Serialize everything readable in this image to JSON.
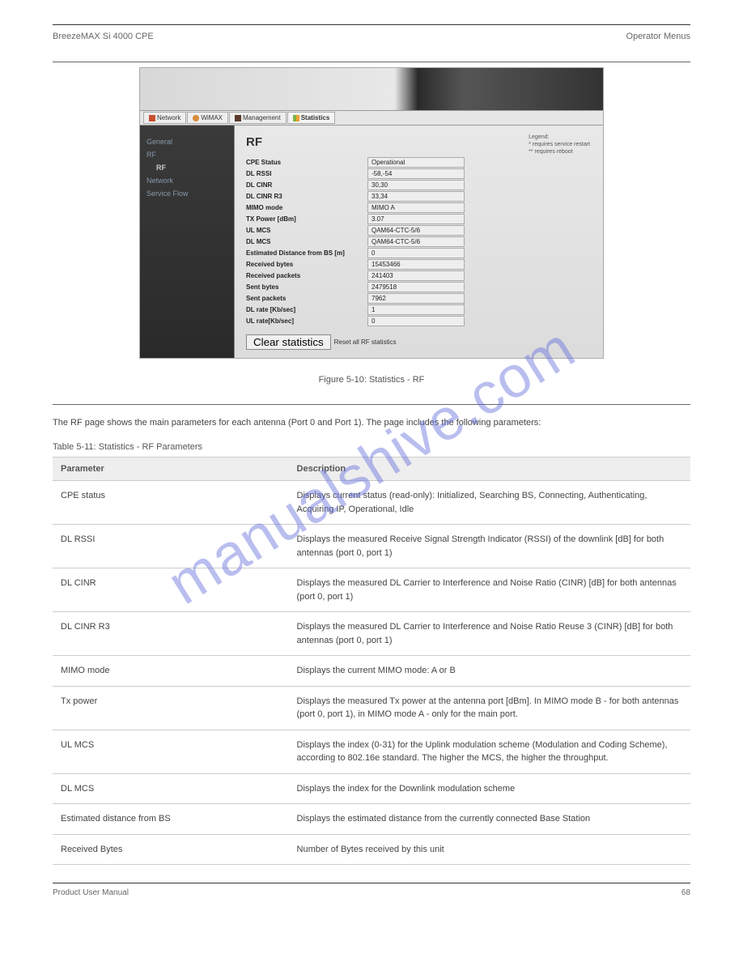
{
  "header": {
    "left": "BreezeMAX Si 4000 CPE",
    "right": "Operator Menus"
  },
  "screenshot": {
    "tabs": [
      {
        "label": "Network"
      },
      {
        "label": "WiMAX"
      },
      {
        "label": "Management"
      },
      {
        "label": "Statistics"
      }
    ],
    "sidebar": {
      "items": [
        {
          "label": "General"
        },
        {
          "label": "RF"
        },
        {
          "label": "RF",
          "child": true
        },
        {
          "label": "Network"
        },
        {
          "label": "Service Flow"
        }
      ]
    },
    "content": {
      "title": "RF",
      "legend": {
        "title": "Legend:",
        "l1": "* requires service restart",
        "l2": "** requires reboot"
      },
      "fields": [
        {
          "label": "CPE Status",
          "value": "Operational"
        },
        {
          "label": "DL RSSI",
          "value": "-58,-54"
        },
        {
          "label": "DL CINR",
          "value": "30,30"
        },
        {
          "label": "DL CINR R3",
          "value": "33,34"
        },
        {
          "label": "MIMO mode",
          "value": "MIMO A"
        },
        {
          "label": "TX Power [dBm]",
          "value": "3.07"
        },
        {
          "label": "UL MCS",
          "value": "QAM64-CTC-5/6"
        },
        {
          "label": "DL MCS",
          "value": "QAM64-CTC-5/6"
        },
        {
          "label": "Estimated Distance from BS [m]",
          "value": "0"
        },
        {
          "label": "Received bytes",
          "value": "15453466"
        },
        {
          "label": "Received packets",
          "value": "241403"
        },
        {
          "label": "Sent bytes",
          "value": "2479518"
        },
        {
          "label": "Sent packets",
          "value": "7962"
        },
        {
          "label": "DL rate [Kb/sec]",
          "value": "1"
        },
        {
          "label": "UL rate[Kb/sec]",
          "value": "0"
        }
      ],
      "buttons": {
        "clear": "Clear statistics",
        "reset": "Reset all RF statistics"
      }
    }
  },
  "caption": "Figure 5-10: Statistics - RF",
  "section_desc": "The RF page shows the main parameters for each antenna (Port 0 and Port 1). The page includes the following parameters:",
  "table_title": "Table 5-11: Statistics - RF Parameters",
  "table": {
    "headers": [
      "Parameter",
      "Description"
    ],
    "rows": [
      [
        "CPE status",
        "Displays current status (read-only): Initialized, Searching BS, Connecting, Authenticating, Acquiring IP, Operational, Idle"
      ],
      [
        "DL RSSI",
        "Displays the measured Receive Signal Strength Indicator (RSSI) of the downlink [dB] for both antennas (port 0, port 1)"
      ],
      [
        "DL CINR",
        "Displays the measured DL Carrier to Interference and Noise Ratio (CINR) [dB] for both antennas (port 0, port 1)"
      ],
      [
        "DL CINR R3",
        "Displays the measured DL Carrier to Interference and Noise Ratio Reuse 3 (CINR) [dB] for both antennas (port 0, port 1)"
      ],
      [
        "MIMO mode",
        "Displays the current MIMO mode: A or B"
      ],
      [
        "Tx power",
        "Displays the measured Tx power at the antenna port [dBm]. In MIMO mode B - for both antennas (port 0, port 1), in MIMO mode A - only for the main port."
      ],
      [
        "UL MCS",
        "Displays the index (0-31) for the Uplink modulation scheme (Modulation and Coding Scheme), according to 802.16e standard. The higher the MCS, the higher the throughput."
      ],
      [
        "DL MCS",
        "Displays the index for the Downlink modulation scheme"
      ],
      [
        "Estimated distance from BS",
        "Displays the estimated distance from the currently connected Base Station"
      ],
      [
        "Received Bytes",
        "Number of Bytes received by this unit"
      ]
    ]
  },
  "footer": {
    "left": "Product User Manual",
    "right": "68"
  },
  "watermark": "manualshive.com"
}
